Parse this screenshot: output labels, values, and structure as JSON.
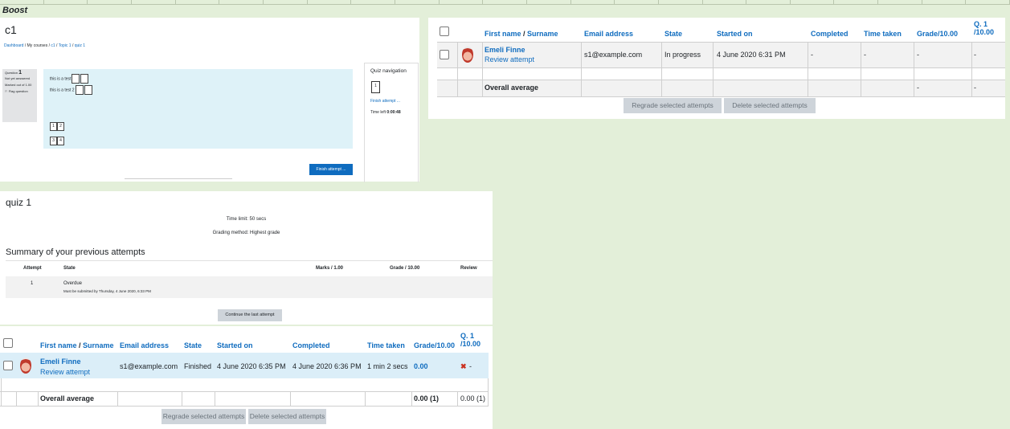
{
  "theme_label": "Boost",
  "attempt_page": {
    "course_title": "c1",
    "breadcrumb": [
      "Dashboard",
      "My courses",
      "c1",
      "Topic 1",
      "quiz 1"
    ],
    "question_info": {
      "question_word": "Question",
      "question_number": "1",
      "status": "Not yet answered",
      "marked": "Marked out of 1.00",
      "flag": "Flag question"
    },
    "question_lines": [
      "this is a test",
      "this is a test 2"
    ],
    "tiles": [
      "1",
      "2",
      "3",
      "4"
    ],
    "finish_button": "Finish attempt ...",
    "navigation": {
      "title": "Quiz navigation",
      "question_button": "1",
      "finish_link": "Finish attempt ...",
      "time_left_label": "Time left",
      "time_left_value": "0:00:48"
    }
  },
  "top_report": {
    "headers": {
      "first_name": "First name",
      "separator": " / ",
      "surname": "Surname",
      "email": "Email address",
      "state": "State",
      "started": "Started on",
      "completed": "Completed",
      "time_taken": "Time taken",
      "grade": "Grade/10.00",
      "q1_line1": "Q. 1",
      "q1_line2": "/10.00"
    },
    "row": {
      "name": "Emeli Finne",
      "review": "Review attempt",
      "email": "s1@example.com",
      "state": "In progress",
      "started": "4 June 2020 6:31 PM",
      "completed": "-",
      "time_taken": "-",
      "grade": "-",
      "q1": "-"
    },
    "average": {
      "label": "Overall average",
      "grade": "-",
      "q1": "-"
    },
    "buttons": {
      "regrade": "Regrade selected attempts",
      "delete": "Delete selected attempts"
    }
  },
  "quiz_summary": {
    "title": "quiz 1",
    "time_limit": "Time limit: 50 secs",
    "grading": "Grading method: Highest grade",
    "section_title": "Summary of your previous attempts",
    "columns": [
      "Attempt",
      "State",
      "Marks / 1.00",
      "Grade / 10.00",
      "Review"
    ],
    "row": {
      "attempt": "1",
      "state": "Overdue",
      "note": "Must be submitted by Thursday, 4 June 2020, 6:33 PM"
    },
    "continue_button": "Continue the last attempt"
  },
  "bottom_report": {
    "headers": {
      "first_name": "First name",
      "separator": " / ",
      "surname": "Surname",
      "email": "Email address",
      "state": "State",
      "started": "Started on",
      "completed": "Completed",
      "time_taken": "Time taken",
      "grade": "Grade/10.00",
      "q1_line1": "Q. 1",
      "q1_line2": "/10.00"
    },
    "row": {
      "name": "Emeli Finne",
      "review": "Review attempt",
      "email": "s1@example.com",
      "state": "Finished",
      "started": "4 June 2020 6:35 PM",
      "completed": "4 June 2020 6:36 PM",
      "time_taken": "1 min 2 secs",
      "grade": "0.00",
      "q1_mark": "✖",
      "q1": "-"
    },
    "average": {
      "label": "Overall average",
      "grade": "0.00 (1)",
      "q1": "0.00 (1)"
    },
    "buttons": {
      "regrade": "Regrade selected attempts",
      "delete": "Delete selected attempts"
    }
  },
  "colors": {
    "link": "#0f6cbf",
    "page_bg": "#e3efd9",
    "highlight_row": "#dbeef8",
    "wrong": "#ca3120"
  }
}
